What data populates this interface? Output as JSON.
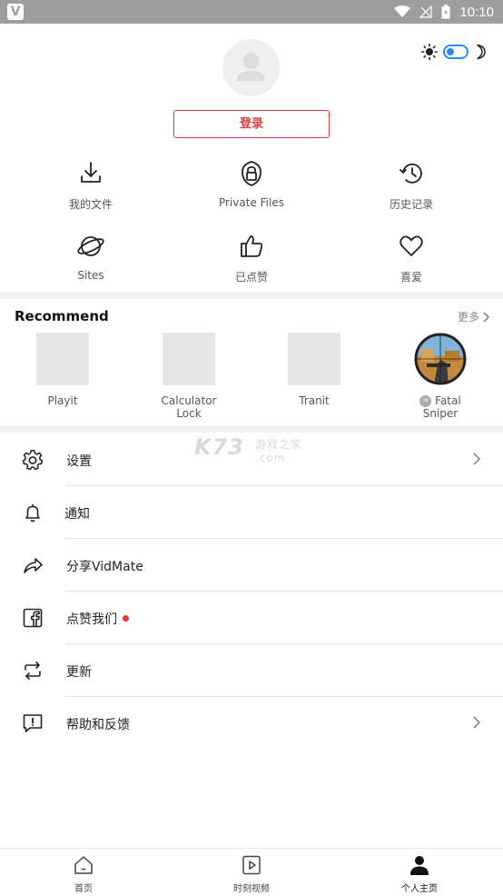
{
  "status_bar": {
    "time": "10:10"
  },
  "profile": {
    "login_label": "登录",
    "quick_actions": [
      {
        "label": "我的文件",
        "icon": "download-icon"
      },
      {
        "label": "Private Files",
        "icon": "lock-icon"
      },
      {
        "label": "历史记录",
        "icon": "history-icon"
      },
      {
        "label": "Sites",
        "icon": "planet-icon"
      },
      {
        "label": "已点赞",
        "icon": "thumbs-up-icon"
      },
      {
        "label": "喜爱",
        "icon": "heart-icon"
      }
    ]
  },
  "recommend": {
    "title": "Recommend",
    "more_label": "更多",
    "apps": [
      {
        "name": "Playit"
      },
      {
        "name_line1": "Calculator",
        "name_line2": "Lock"
      },
      {
        "name": "Tranit"
      },
      {
        "name_line1": "Fatal",
        "name_line2": "Sniper"
      }
    ]
  },
  "menu": [
    {
      "label": "设置",
      "icon": "gear-icon",
      "has_arrow": true
    },
    {
      "label": "通知",
      "icon": "bell-icon"
    },
    {
      "label": "分享VidMate",
      "icon": "share-icon"
    },
    {
      "label": "点赞我们",
      "icon": "facebook-icon",
      "badge": true
    },
    {
      "label": "更新",
      "icon": "refresh-icon"
    },
    {
      "label": "帮助和反馈",
      "icon": "feedback-icon",
      "has_arrow": true
    }
  ],
  "watermark": {
    "main": "K73",
    "sub": "游戏之家",
    "domain": ".com"
  },
  "bottom_nav": [
    {
      "label": "首页",
      "icon": "home-icon"
    },
    {
      "label": "时刻视频",
      "icon": "video-icon"
    },
    {
      "label": "个人主页",
      "icon": "person-icon",
      "active": true
    }
  ],
  "colors": {
    "accent_red": "#e0383e",
    "toggle_blue": "#2a8cf0",
    "status_bar": "#9e9e9e",
    "separator": "#f2f2f2"
  }
}
